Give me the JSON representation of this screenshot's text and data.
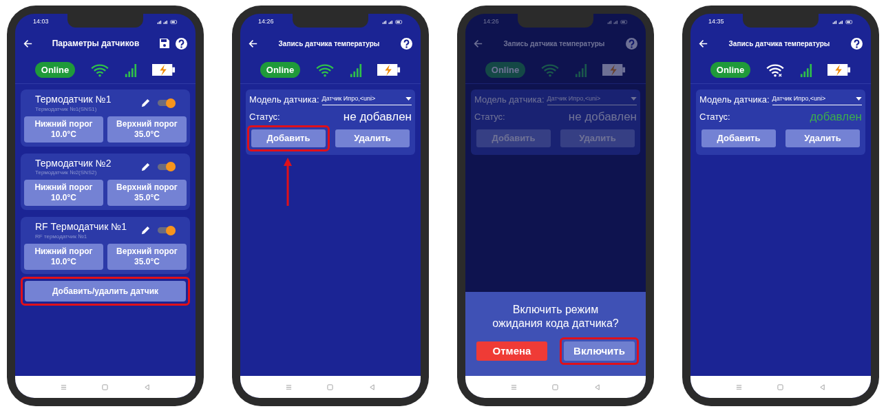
{
  "phones": [
    {
      "kind": "sensor_list",
      "time": "14:03",
      "title": "Параметры датчиков",
      "save_button": true,
      "online": "Online",
      "wifi_connected": true,
      "dimmed": false,
      "sensors": [
        {
          "name": "Термодатчик №1",
          "subtitle": "Термодатчик №1(SNS1)",
          "on": true,
          "low_label": "Нижний порог",
          "low": "10.0°C",
          "high_label": "Верхний порог",
          "high": "35.0°C"
        },
        {
          "name": "Термодатчик №2",
          "subtitle": "Термодатчик №2(SNS2)",
          "on": true,
          "low_label": "Нижний порог",
          "low": "10.0°C",
          "high_label": "Верхний порог",
          "high": "35.0°C"
        },
        {
          "name": "RF Термодатчик №1",
          "subtitle": "RF термодатчик №1",
          "on": true,
          "low_label": "Нижний порог",
          "low": "10.0°C",
          "high_label": "Верхний порог",
          "high": "35.0°C"
        }
      ],
      "action": {
        "label": "Добавить/удалить датчик",
        "highlighted": true
      }
    },
    {
      "kind": "sensor_record",
      "time": "14:26",
      "title": "Запись датчика температуры",
      "online": "Online",
      "wifi_connected": true,
      "dimmed": false,
      "arrow": true,
      "model_label": "Модель датчика:",
      "model": "Датчик Ипро,<uni>",
      "status_label": "Статус:",
      "status": "не добавлен",
      "added": false,
      "buttons": [
        {
          "label": "Добавить",
          "highlighted": true
        },
        {
          "label": "Удалить",
          "highlighted": false
        }
      ]
    },
    {
      "kind": "sensor_record",
      "time": "14:26",
      "title": "Запись датчика температуры",
      "online": "Online",
      "wifi_connected": true,
      "dimmed": true,
      "model_label": "Модель датчика:",
      "model": "Датчик Ипро,<uni>",
      "status_label": "Статус:",
      "status": "не добавлен",
      "added": false,
      "buttons": [
        {
          "label": "Добавить",
          "highlighted": false
        },
        {
          "label": "Удалить",
          "highlighted": false
        }
      ],
      "dialog": {
        "message": "Включить режим ожидания кода датчика?",
        "buttons": [
          {
            "label": "Отмена",
            "kind": "cancel",
            "highlighted": false
          },
          {
            "label": "Включить",
            "kind": "confirm",
            "highlighted": true
          }
        ]
      }
    },
    {
      "kind": "sensor_record",
      "time": "14:35",
      "title": "Запись датчика температуры",
      "online": "Online",
      "wifi_connected": false,
      "dimmed": false,
      "model_label": "Модель датчика:",
      "model": "Датчик Ипро,<uni>",
      "status_label": "Статус:",
      "status": "добавлен",
      "added": true,
      "buttons": [
        {
          "label": "Добавить",
          "highlighted": false
        },
        {
          "label": "Удалить",
          "highlighted": false
        }
      ]
    }
  ]
}
